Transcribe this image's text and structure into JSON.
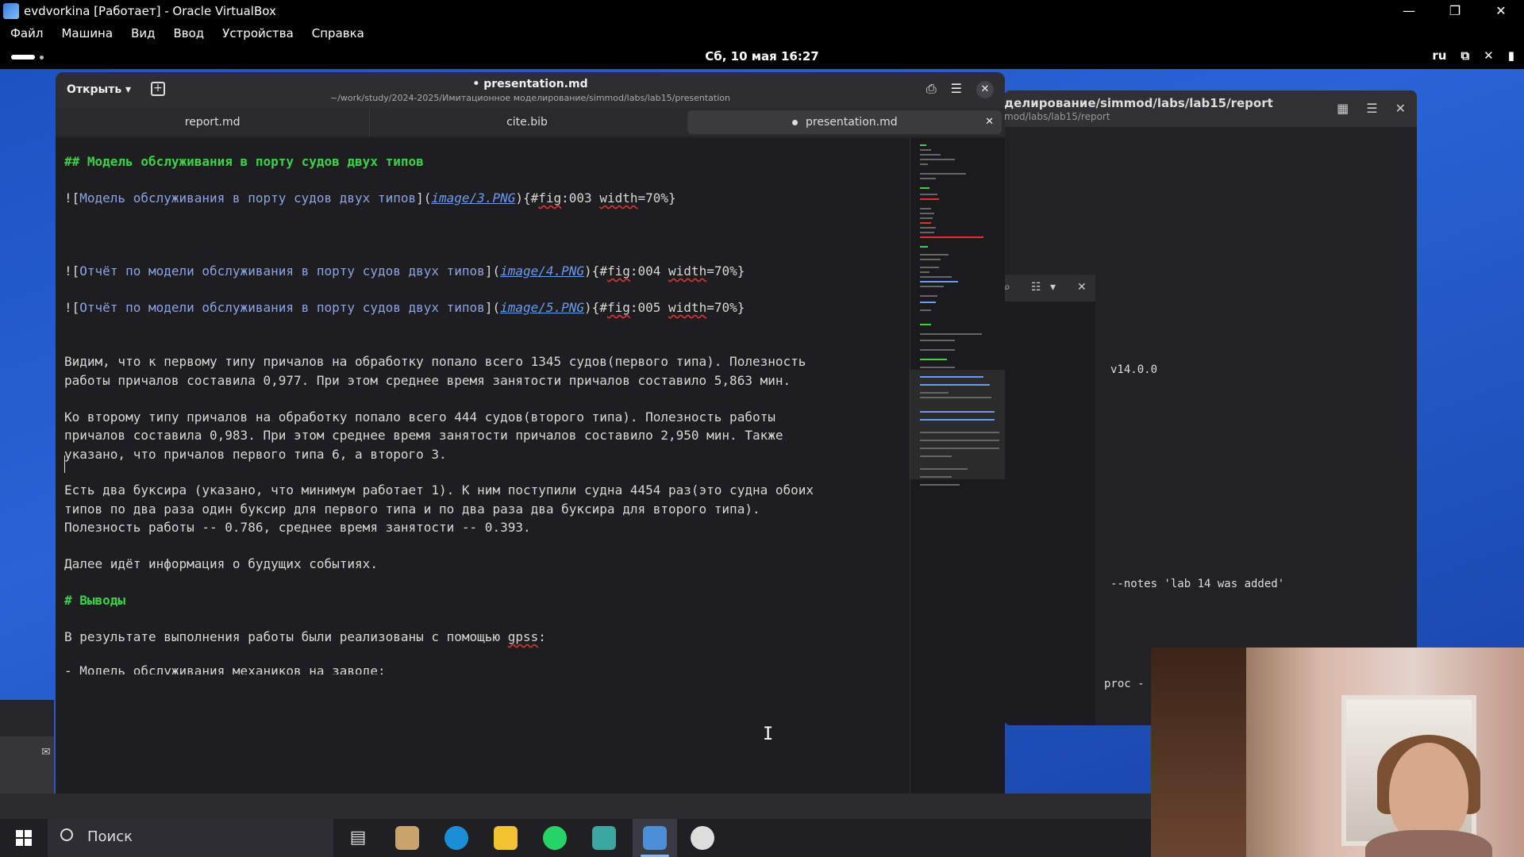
{
  "vbox": {
    "title": "evdvorkina [Работает] - Oracle VirtualBox",
    "menu": [
      "Файл",
      "Машина",
      "Вид",
      "Ввод",
      "Устройства",
      "Справка"
    ],
    "controls": [
      "—",
      "❐",
      "✕"
    ]
  },
  "gnome": {
    "clock": "Сб, 10 мая  16:27",
    "lang": "ru"
  },
  "gedit": {
    "open_label": "Открыть",
    "title": "• presentation.md",
    "subtitle": "~/work/study/2024-2025/Имитационное моделирование/simmod/labs/lab15/presentation",
    "tabs": [
      {
        "label": "report.md"
      },
      {
        "label": "cite.bib"
      },
      {
        "label": "presentation.md",
        "close": "✕"
      }
    ]
  },
  "editor": {
    "l1": "## Модель обслуживания в порту судов двух типов",
    "l2": {
      "pre": "![",
      "alt": "Модель обслуживания в порту судов двух типов",
      "mid": "](",
      "link": "image/3.PNG",
      "post": "){#",
      "fig": "fig",
      "tail": ":003 ",
      "w": "width",
      "end": "=70%}"
    },
    "l3": {
      "pre": "![",
      "alt": "Отчёт по модели обслуживания в порту судов двух типов",
      "mid": "](",
      "link": "image/4.PNG",
      "post": "){#",
      "fig": "fig",
      "tail": ":004 ",
      "w": "width",
      "end": "=70%}"
    },
    "l4": {
      "pre": "![",
      "alt": "Отчёт по модели обслуживания в порту судов двух типов",
      "mid": "](",
      "link": "image/5.PNG",
      "post": "){#",
      "fig": "fig",
      "tail": ":005 ",
      "w": "width",
      "end": "=70%}"
    },
    "p1a": "Видим, что к первому типу причалов на обработку попало всего 1345 судов(первого типа). Полезность",
    "p1b": "работы причалов составила 0,977. При этом среднее время занятости причалов составило 5,863 мин.",
    "p2a": "Ко второму типу причалов на обработку попало всего 444 судов(второго типа). Полезность работы",
    "p2b": "причалов составила 0,983. При этом среднее время занятости причалов составило 2,950 мин. Также",
    "p2c": "указано, что причалов первого типа 6, а второго 3.",
    "p3a": "Есть два буксира (указано, что минимум работает 1). К ним поступили судна 4454 раз(это судна обоих",
    "p3b": "типов по два раза один буксир для первого типа и по два раза два буксира для второго типа).",
    "p3c": "Полезность работы -- 0.786, среднее время занятости -- 0.393.",
    "p4": "Далее идёт информация о будущих событиях.",
    "h2": "# Выводы",
    "p5a": "В результате выполнения работы были реализованы с помощью ",
    "p5b": "gpss",
    "p5c": ":",
    "p6": "- Модель обслуживания механиков на заводе;"
  },
  "bg_terminal": {
    "title": "делирование/simmod/labs/lab15/report",
    "subtitle": "mod/labs/lab15/report",
    "version": "v14.0.0",
    "notes": "--notes 'lab 14 was added'",
    "proc": "proc  -"
  },
  "taskbar": {
    "search_label": "Поиск"
  },
  "colors": {
    "heading": "#3ecf4b",
    "alt_text": "#8da3e6",
    "link": "#6a9bf0",
    "editor_bg": "#1e1e20",
    "desktop": "#1d52c2"
  }
}
